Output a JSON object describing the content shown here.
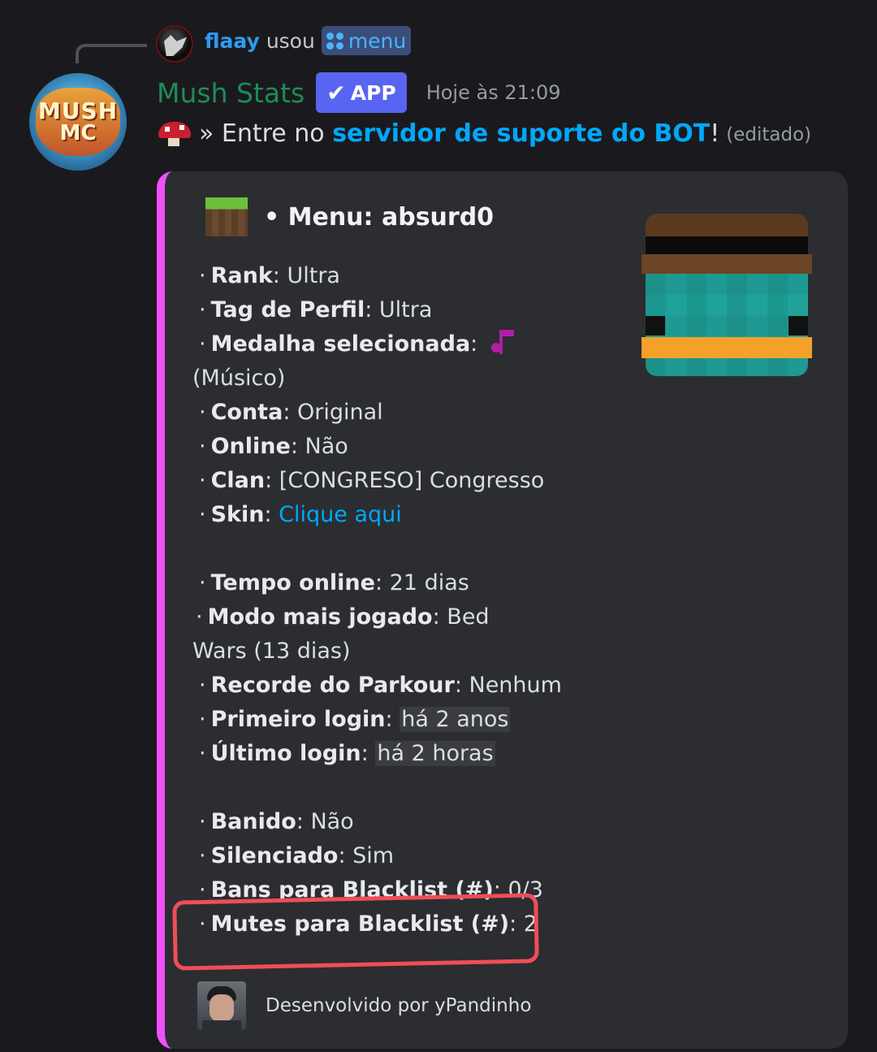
{
  "reply": {
    "user": "flaay",
    "verb": "usou",
    "command": "menu",
    "avatar_icon": "wolf-avatar-icon"
  },
  "message": {
    "bot_name": "Mush Stats",
    "badge": "APP",
    "timestamp": "Hoje às 21:09",
    "avatar_logo": {
      "line1": "MUSH",
      "line2": "MC"
    },
    "content_prefix": "» Entre no ",
    "content_link": "servidor de suporte do BOT",
    "content_suffix": "!",
    "edited": "(editado)"
  },
  "embed": {
    "accent_color": "#f050f8",
    "title": "• Menu: absurd0",
    "fields": [
      {
        "label": "Rank",
        "sep": ": ",
        "value": "Ultra"
      },
      {
        "label": "Tag de Perfil",
        "sep": ": ",
        "value": "Ultra"
      },
      {
        "label": "Medalha selecionada",
        "sep": ": ",
        "value": "(Músico)"
      },
      {
        "label": "Conta",
        "sep": ": ",
        "value": "Original"
      },
      {
        "label": "Online",
        "sep": ": ",
        "value": "Não"
      },
      {
        "label": "Clan",
        "sep": ": ",
        "value": "[CONGRESO] Congresso"
      },
      {
        "label": "Skin",
        "sep": ": ",
        "value": "Clique aqui"
      },
      {
        "label": "Tempo online",
        "sep": ": ",
        "value": "21 dias"
      },
      {
        "label": "Modo mais jogado",
        "sep": ": ",
        "value": "Bed Wars (13 dias)"
      },
      {
        "label": "Recorde do Parkour",
        "sep": ": ",
        "value": "Nenhum"
      },
      {
        "label": "Primeiro login",
        "sep": ": ",
        "value": "há 2 anos"
      },
      {
        "label": "Último login",
        "sep": ": ",
        "value": "há 2 horas"
      },
      {
        "label": "Banido",
        "sep": ": ",
        "value": "Não"
      },
      {
        "label": "Silenciado",
        "sep": ": ",
        "value": "Sim"
      },
      {
        "label": "Bans para Blacklist (#)",
        "sep": ": ",
        "value": "0/3"
      },
      {
        "label": "Mutes para Blacklist (#)",
        "sep": ": ",
        "value": "2"
      }
    ],
    "footer": "Desenvolvido por yPandinho"
  },
  "colors": {
    "background": "#1a1a1e",
    "embed_bg": "#2b2d31",
    "link": "#00a8fc",
    "bot_name": "#1f8b58",
    "highlight_ring": "#f04d58"
  }
}
